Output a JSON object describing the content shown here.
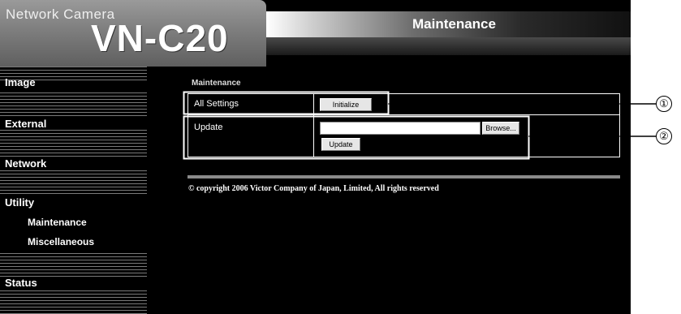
{
  "header": {
    "brand": "Network Camera",
    "model": "VN-C20",
    "title": "Maintenance"
  },
  "sidebar": {
    "items": [
      {
        "label": "Image"
      },
      {
        "label": "External"
      },
      {
        "label": "Network"
      },
      {
        "label": "Utility"
      },
      {
        "label": "Maintenance"
      },
      {
        "label": "Miscellaneous"
      },
      {
        "label": "Status"
      }
    ]
  },
  "main": {
    "section_title": "Maintenance",
    "rows": [
      {
        "label": "All Settings",
        "button": "Initialize"
      },
      {
        "label": "Update",
        "browse": "Browse...",
        "button": "Update",
        "file_value": ""
      }
    ],
    "copyright": "© copyright 2006 Victor Company of Japan, Limited, All rights reserved"
  },
  "callouts": [
    "①",
    "②"
  ]
}
